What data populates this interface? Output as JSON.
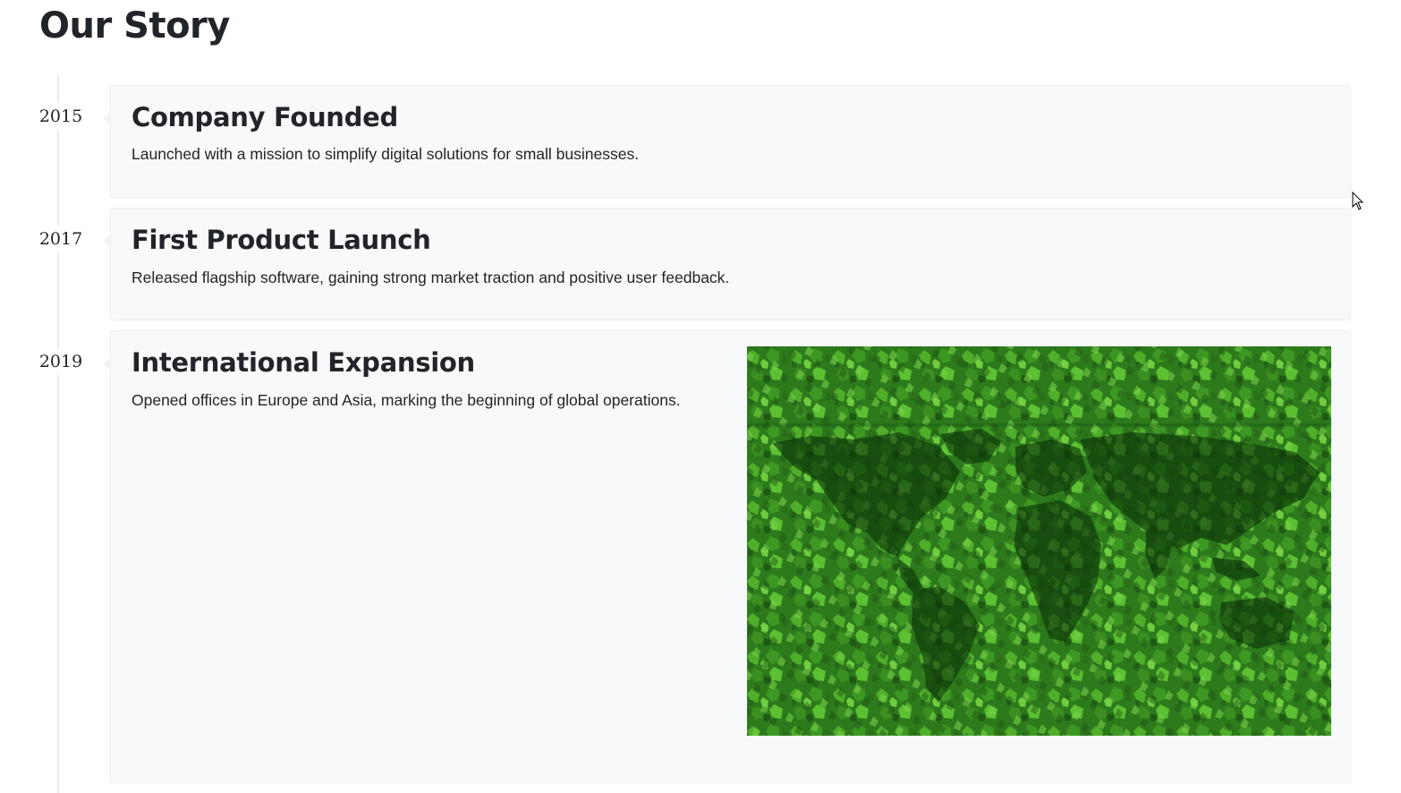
{
  "page": {
    "title": "Our Story"
  },
  "timeline": [
    {
      "year": "2015",
      "title": "Company Founded",
      "description": "Launched with a mission to simplify digital solutions for small businesses."
    },
    {
      "year": "2017",
      "title": "First Product Launch",
      "description": "Released flagship software, gaining strong market traction and positive user feedback."
    },
    {
      "year": "2019",
      "title": "International Expansion",
      "description": "Opened offices in Europe and Asia, marking the beginning of global operations.",
      "image": "world-map-ivy-image"
    }
  ],
  "colors": {
    "card_background": "#f8f9fa",
    "timeline_line": "#e9ecef",
    "text": "#212529",
    "ivy_green": "#2f8a1f",
    "ivy_dark": "#0d3d0a"
  }
}
